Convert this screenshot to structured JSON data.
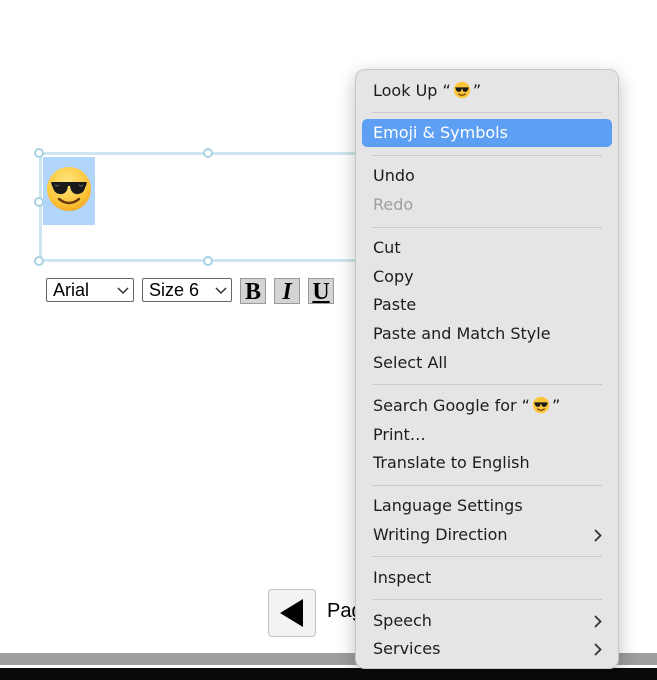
{
  "editor": {
    "emoji_icon": "smiling-face-with-sunglasses-emoji",
    "font_value": "Arial",
    "size_value": "Size 6",
    "bold_label": "B",
    "italic_label": "I",
    "underline_label": "U"
  },
  "pager": {
    "page_label": "Pag"
  },
  "context_menu": {
    "look_up_prefix": "Look Up “",
    "look_up_suffix": "”",
    "emoji_symbols": "Emoji & Symbols",
    "undo": "Undo",
    "redo": "Redo",
    "cut": "Cut",
    "copy": "Copy",
    "paste": "Paste",
    "paste_match_style": "Paste and Match Style",
    "select_all": "Select All",
    "search_google_prefix": "Search Google for “",
    "search_google_suffix": "”",
    "print": "Print…",
    "translate": "Translate to English",
    "language_settings": "Language Settings",
    "writing_direction": "Writing Direction",
    "inspect": "Inspect",
    "speech": "Speech",
    "services": "Services"
  },
  "colors": {
    "menu_highlight": "#5d9ff3",
    "selection": "#b2d5fb",
    "textbox_border": "#cfe5ef"
  }
}
